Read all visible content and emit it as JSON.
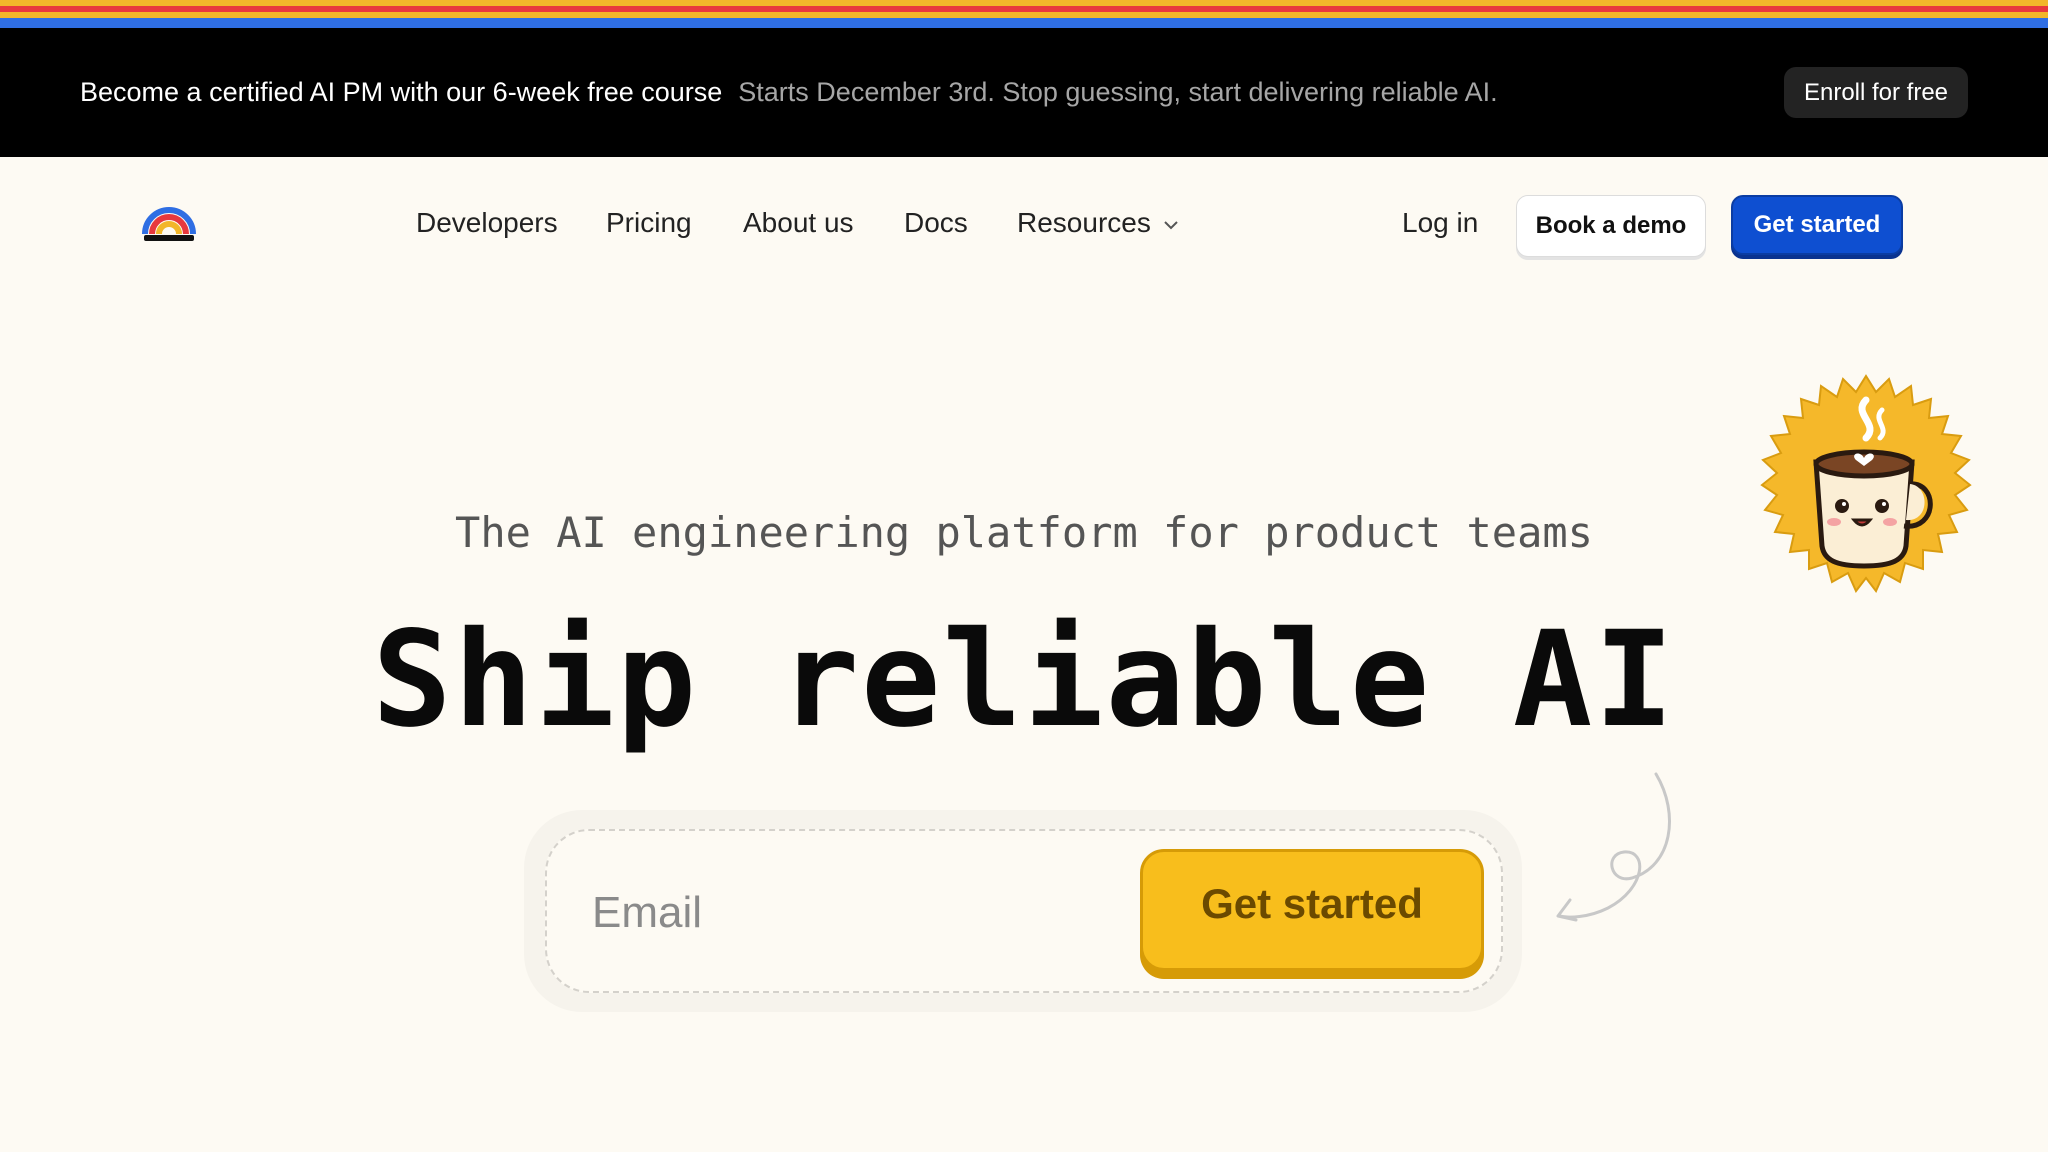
{
  "colors": {
    "announce_bg": "#000000",
    "page_bg": "#fdfaf3",
    "primary_blue": "#0e4fd1",
    "cta_yellow": "#f8be1c",
    "stripe": [
      "#f2b62a",
      "#e8383d",
      "#2f6ee3"
    ]
  },
  "announcement": {
    "main": "Become a certified AI PM with our 6-week free course",
    "sub": "Starts December 3rd. Stop guessing, start delivering reliable AI.",
    "button": "Enroll for free"
  },
  "nav": {
    "logo_icon": "rainbow-logo-icon",
    "links": [
      "Developers",
      "Pricing",
      "About us",
      "Docs"
    ],
    "resources": "Resources",
    "login": "Log in",
    "demo": "Book a demo",
    "start": "Get started"
  },
  "hero": {
    "tagline": "The AI engineering platform for product teams",
    "headline": "Ship reliable AI",
    "email_placeholder": "Email",
    "cta": "Get started",
    "badge_icon": "coffee-mug-badge-icon",
    "arrow_icon": "curly-arrow-icon"
  }
}
